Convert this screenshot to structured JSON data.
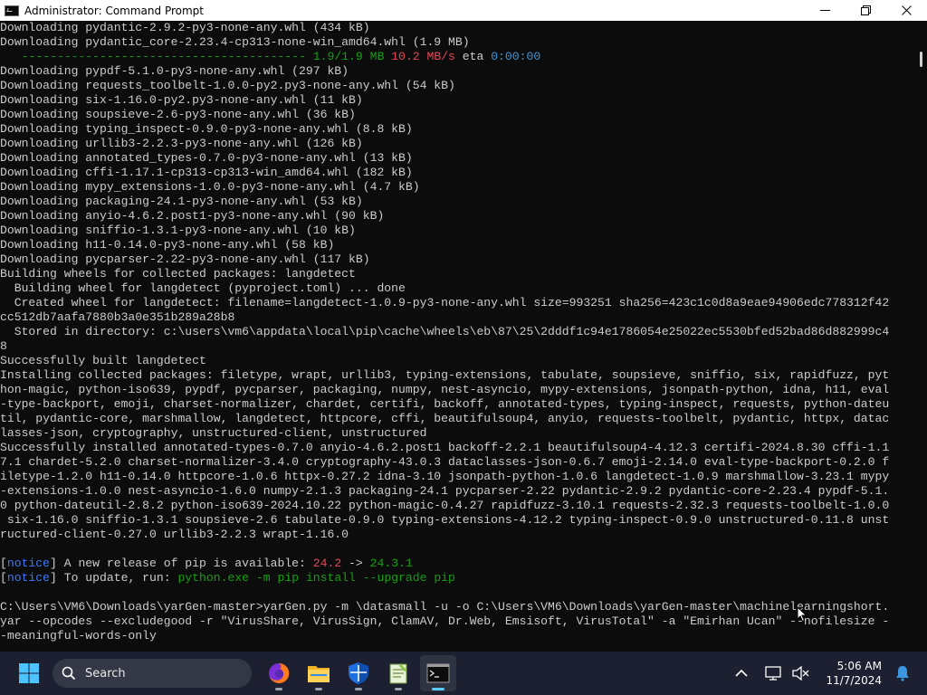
{
  "window": {
    "title": "Administrator: Command Prompt",
    "controls": {
      "minimize": "minimize",
      "maximize": "maximize",
      "close": "close"
    }
  },
  "console": {
    "lines": [
      [
        {
          "t": "Downloading pydantic-2.9.2-py3-none-any.whl (434 kB)"
        }
      ],
      [
        {
          "t": "Downloading pydantic_core-2.23.4-cp313-none-win_amd64.whl (1.9 MB)"
        }
      ],
      [
        {
          "t": "   "
        },
        {
          "t": "----------------------------------------",
          "c": "green"
        },
        {
          "t": " "
        },
        {
          "t": "1.9/1.9 MB",
          "c": "green"
        },
        {
          "t": " "
        },
        {
          "t": "10.2 MB/s",
          "c": "red"
        },
        {
          "t": " eta "
        },
        {
          "t": "0:00:00",
          "c": "cyan"
        }
      ],
      [
        {
          "t": "Downloading pypdf-5.1.0-py3-none-any.whl (297 kB)"
        }
      ],
      [
        {
          "t": "Downloading requests_toolbelt-1.0.0-py2.py3-none-any.whl (54 kB)"
        }
      ],
      [
        {
          "t": "Downloading six-1.16.0-py2.py3-none-any.whl (11 kB)"
        }
      ],
      [
        {
          "t": "Downloading soupsieve-2.6-py3-none-any.whl (36 kB)"
        }
      ],
      [
        {
          "t": "Downloading typing_inspect-0.9.0-py3-none-any.whl (8.8 kB)"
        }
      ],
      [
        {
          "t": "Downloading urllib3-2.2.3-py3-none-any.whl (126 kB)"
        }
      ],
      [
        {
          "t": "Downloading annotated_types-0.7.0-py3-none-any.whl (13 kB)"
        }
      ],
      [
        {
          "t": "Downloading cffi-1.17.1-cp313-cp313-win_amd64.whl (182 kB)"
        }
      ],
      [
        {
          "t": "Downloading mypy_extensions-1.0.0-py3-none-any.whl (4.7 kB)"
        }
      ],
      [
        {
          "t": "Downloading packaging-24.1-py3-none-any.whl (53 kB)"
        }
      ],
      [
        {
          "t": "Downloading anyio-4.6.2.post1-py3-none-any.whl (90 kB)"
        }
      ],
      [
        {
          "t": "Downloading sniffio-1.3.1-py3-none-any.whl (10 kB)"
        }
      ],
      [
        {
          "t": "Downloading h11-0.14.0-py3-none-any.whl (58 kB)"
        }
      ],
      [
        {
          "t": "Downloading pycparser-2.22-py3-none-any.whl (117 kB)"
        }
      ],
      [
        {
          "t": "Building wheels for collected packages: langdetect"
        }
      ],
      [
        {
          "t": "  Building wheel for langdetect (pyproject.toml) ... done"
        }
      ],
      [
        {
          "t": "  Created wheel for langdetect: filename=langdetect-1.0.9-py3-none-any.whl size=993251 sha256=423c1c0d8a9eae94906edc778312f42"
        }
      ],
      [
        {
          "t": "cc512db7aafa7880b3a0e351b289a28b8"
        }
      ],
      [
        {
          "t": "  Stored in directory: c:\\users\\vm6\\appdata\\local\\pip\\cache\\wheels\\eb\\87\\25\\2dddf1c94e1786054e25022ec5530bfed52bad86d882999c4"
        }
      ],
      [
        {
          "t": "8"
        }
      ],
      [
        {
          "t": "Successfully built langdetect"
        }
      ],
      [
        {
          "t": "Installing collected packages: filetype, wrapt, urllib3, typing-extensions, tabulate, soupsieve, sniffio, six, rapidfuzz, pyt"
        }
      ],
      [
        {
          "t": "hon-magic, python-iso639, pypdf, pycparser, packaging, numpy, nest-asyncio, mypy-extensions, jsonpath-python, idna, h11, eval"
        }
      ],
      [
        {
          "t": "-type-backport, emoji, charset-normalizer, chardet, certifi, backoff, annotated-types, typing-inspect, requests, python-dateu"
        }
      ],
      [
        {
          "t": "til, pydantic-core, marshmallow, langdetect, httpcore, cffi, beautifulsoup4, anyio, requests-toolbelt, pydantic, httpx, datac"
        }
      ],
      [
        {
          "t": "lasses-json, cryptography, unstructured-client, unstructured"
        }
      ],
      [
        {
          "t": "Successfully installed annotated-types-0.7.0 anyio-4.6.2.post1 backoff-2.2.1 beautifulsoup4-4.12.3 certifi-2024.8.30 cffi-1.1"
        }
      ],
      [
        {
          "t": "7.1 chardet-5.2.0 charset-normalizer-3.4.0 cryptography-43.0.3 dataclasses-json-0.6.7 emoji-2.14.0 eval-type-backport-0.2.0 f"
        }
      ],
      [
        {
          "t": "iletype-1.2.0 h11-0.14.0 httpcore-1.0.6 httpx-0.27.2 idna-3.10 jsonpath-python-1.0.6 langdetect-1.0.9 marshmallow-3.23.1 mypy"
        }
      ],
      [
        {
          "t": "-extensions-1.0.0 nest-asyncio-1.6.0 numpy-2.1.3 packaging-24.1 pycparser-2.22 pydantic-2.9.2 pydantic-core-2.23.4 pypdf-5.1."
        }
      ],
      [
        {
          "t": "0 python-dateutil-2.8.2 python-iso639-2024.10.22 python-magic-0.4.27 rapidfuzz-3.10.1 requests-2.32.3 requests-toolbelt-1.0.0"
        }
      ],
      [
        {
          "t": " six-1.16.0 sniffio-1.3.1 soupsieve-2.6 tabulate-0.9.0 typing-extensions-4.12.2 typing-inspect-0.9.0 unstructured-0.11.8 unst"
        }
      ],
      [
        {
          "t": "ructured-client-0.27.0 urllib3-2.2.3 wrapt-1.16.0"
        }
      ],
      [
        {
          "t": ""
        }
      ],
      [
        {
          "t": "["
        },
        {
          "t": "notice",
          "c": "blue"
        },
        {
          "t": "] A new release of pip is available: "
        },
        {
          "t": "24.2",
          "c": "red"
        },
        {
          "t": " -> "
        },
        {
          "t": "24.3.1",
          "c": "green"
        }
      ],
      [
        {
          "t": "["
        },
        {
          "t": "notice",
          "c": "blue"
        },
        {
          "t": "] To update, run: "
        },
        {
          "t": "python.exe -m pip install --upgrade pip",
          "c": "green"
        }
      ],
      [
        {
          "t": ""
        }
      ],
      [
        {
          "t": "C:\\Users\\VM6\\Downloads\\yarGen-master>yarGen.py -m \\datasmall -u -o C:\\Users\\VM6\\Downloads\\yarGen-master\\machinelearningshort."
        }
      ],
      [
        {
          "t": "yar --opcodes --excludegood -r \"VirusShare, VirusSign, ClamAV, Dr.Web, Emsisoft, VirusTotal\" -a \"Emirhan Ucan\" --nofilesize -"
        }
      ],
      [
        {
          "t": "-meaningful-words-only"
        }
      ]
    ]
  },
  "taskbar": {
    "search_placeholder": "Search",
    "apps": [
      {
        "name": "firefox",
        "active": false
      },
      {
        "name": "file-explorer",
        "active": false
      },
      {
        "name": "defender",
        "active": false
      },
      {
        "name": "notepad-plus",
        "active": false
      },
      {
        "name": "terminal",
        "active": true
      }
    ],
    "time": "5:06 AM",
    "date": "11/7/2024"
  },
  "colors": {
    "green": "#13a10e",
    "red": "#e74856",
    "cyan": "#3a96dd",
    "blue": "#3b78ff",
    "taskbar_bg": "#1c2030",
    "console_bg": "#0c0c0c"
  }
}
